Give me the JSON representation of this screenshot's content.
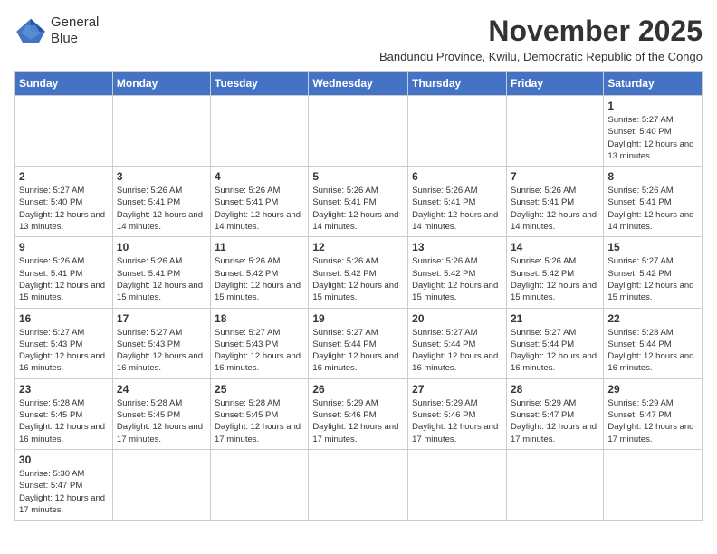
{
  "logo": {
    "line1": "General",
    "line2": "Blue"
  },
  "title": "November 2025",
  "subtitle": "Bandundu Province, Kwilu, Democratic Republic of the Congo",
  "weekdays": [
    "Sunday",
    "Monday",
    "Tuesday",
    "Wednesday",
    "Thursday",
    "Friday",
    "Saturday"
  ],
  "weeks": [
    [
      {
        "day": "",
        "info": ""
      },
      {
        "day": "",
        "info": ""
      },
      {
        "day": "",
        "info": ""
      },
      {
        "day": "",
        "info": ""
      },
      {
        "day": "",
        "info": ""
      },
      {
        "day": "",
        "info": ""
      },
      {
        "day": "1",
        "info": "Sunrise: 5:27 AM\nSunset: 5:40 PM\nDaylight: 12 hours and 13 minutes."
      }
    ],
    [
      {
        "day": "2",
        "info": "Sunrise: 5:27 AM\nSunset: 5:40 PM\nDaylight: 12 hours and 13 minutes."
      },
      {
        "day": "3",
        "info": "Sunrise: 5:26 AM\nSunset: 5:41 PM\nDaylight: 12 hours and 14 minutes."
      },
      {
        "day": "4",
        "info": "Sunrise: 5:26 AM\nSunset: 5:41 PM\nDaylight: 12 hours and 14 minutes."
      },
      {
        "day": "5",
        "info": "Sunrise: 5:26 AM\nSunset: 5:41 PM\nDaylight: 12 hours and 14 minutes."
      },
      {
        "day": "6",
        "info": "Sunrise: 5:26 AM\nSunset: 5:41 PM\nDaylight: 12 hours and 14 minutes."
      },
      {
        "day": "7",
        "info": "Sunrise: 5:26 AM\nSunset: 5:41 PM\nDaylight: 12 hours and 14 minutes."
      },
      {
        "day": "8",
        "info": "Sunrise: 5:26 AM\nSunset: 5:41 PM\nDaylight: 12 hours and 14 minutes."
      }
    ],
    [
      {
        "day": "9",
        "info": "Sunrise: 5:26 AM\nSunset: 5:41 PM\nDaylight: 12 hours and 15 minutes."
      },
      {
        "day": "10",
        "info": "Sunrise: 5:26 AM\nSunset: 5:41 PM\nDaylight: 12 hours and 15 minutes."
      },
      {
        "day": "11",
        "info": "Sunrise: 5:26 AM\nSunset: 5:42 PM\nDaylight: 12 hours and 15 minutes."
      },
      {
        "day": "12",
        "info": "Sunrise: 5:26 AM\nSunset: 5:42 PM\nDaylight: 12 hours and 15 minutes."
      },
      {
        "day": "13",
        "info": "Sunrise: 5:26 AM\nSunset: 5:42 PM\nDaylight: 12 hours and 15 minutes."
      },
      {
        "day": "14",
        "info": "Sunrise: 5:26 AM\nSunset: 5:42 PM\nDaylight: 12 hours and 15 minutes."
      },
      {
        "day": "15",
        "info": "Sunrise: 5:27 AM\nSunset: 5:42 PM\nDaylight: 12 hours and 15 minutes."
      }
    ],
    [
      {
        "day": "16",
        "info": "Sunrise: 5:27 AM\nSunset: 5:43 PM\nDaylight: 12 hours and 16 minutes."
      },
      {
        "day": "17",
        "info": "Sunrise: 5:27 AM\nSunset: 5:43 PM\nDaylight: 12 hours and 16 minutes."
      },
      {
        "day": "18",
        "info": "Sunrise: 5:27 AM\nSunset: 5:43 PM\nDaylight: 12 hours and 16 minutes."
      },
      {
        "day": "19",
        "info": "Sunrise: 5:27 AM\nSunset: 5:44 PM\nDaylight: 12 hours and 16 minutes."
      },
      {
        "day": "20",
        "info": "Sunrise: 5:27 AM\nSunset: 5:44 PM\nDaylight: 12 hours and 16 minutes."
      },
      {
        "day": "21",
        "info": "Sunrise: 5:27 AM\nSunset: 5:44 PM\nDaylight: 12 hours and 16 minutes."
      },
      {
        "day": "22",
        "info": "Sunrise: 5:28 AM\nSunset: 5:44 PM\nDaylight: 12 hours and 16 minutes."
      }
    ],
    [
      {
        "day": "23",
        "info": "Sunrise: 5:28 AM\nSunset: 5:45 PM\nDaylight: 12 hours and 16 minutes."
      },
      {
        "day": "24",
        "info": "Sunrise: 5:28 AM\nSunset: 5:45 PM\nDaylight: 12 hours and 17 minutes."
      },
      {
        "day": "25",
        "info": "Sunrise: 5:28 AM\nSunset: 5:45 PM\nDaylight: 12 hours and 17 minutes."
      },
      {
        "day": "26",
        "info": "Sunrise: 5:29 AM\nSunset: 5:46 PM\nDaylight: 12 hours and 17 minutes."
      },
      {
        "day": "27",
        "info": "Sunrise: 5:29 AM\nSunset: 5:46 PM\nDaylight: 12 hours and 17 minutes."
      },
      {
        "day": "28",
        "info": "Sunrise: 5:29 AM\nSunset: 5:47 PM\nDaylight: 12 hours and 17 minutes."
      },
      {
        "day": "29",
        "info": "Sunrise: 5:29 AM\nSunset: 5:47 PM\nDaylight: 12 hours and 17 minutes."
      }
    ],
    [
      {
        "day": "30",
        "info": "Sunrise: 5:30 AM\nSunset: 5:47 PM\nDaylight: 12 hours and 17 minutes."
      },
      {
        "day": "",
        "info": ""
      },
      {
        "day": "",
        "info": ""
      },
      {
        "day": "",
        "info": ""
      },
      {
        "day": "",
        "info": ""
      },
      {
        "day": "",
        "info": ""
      },
      {
        "day": "",
        "info": ""
      }
    ]
  ]
}
